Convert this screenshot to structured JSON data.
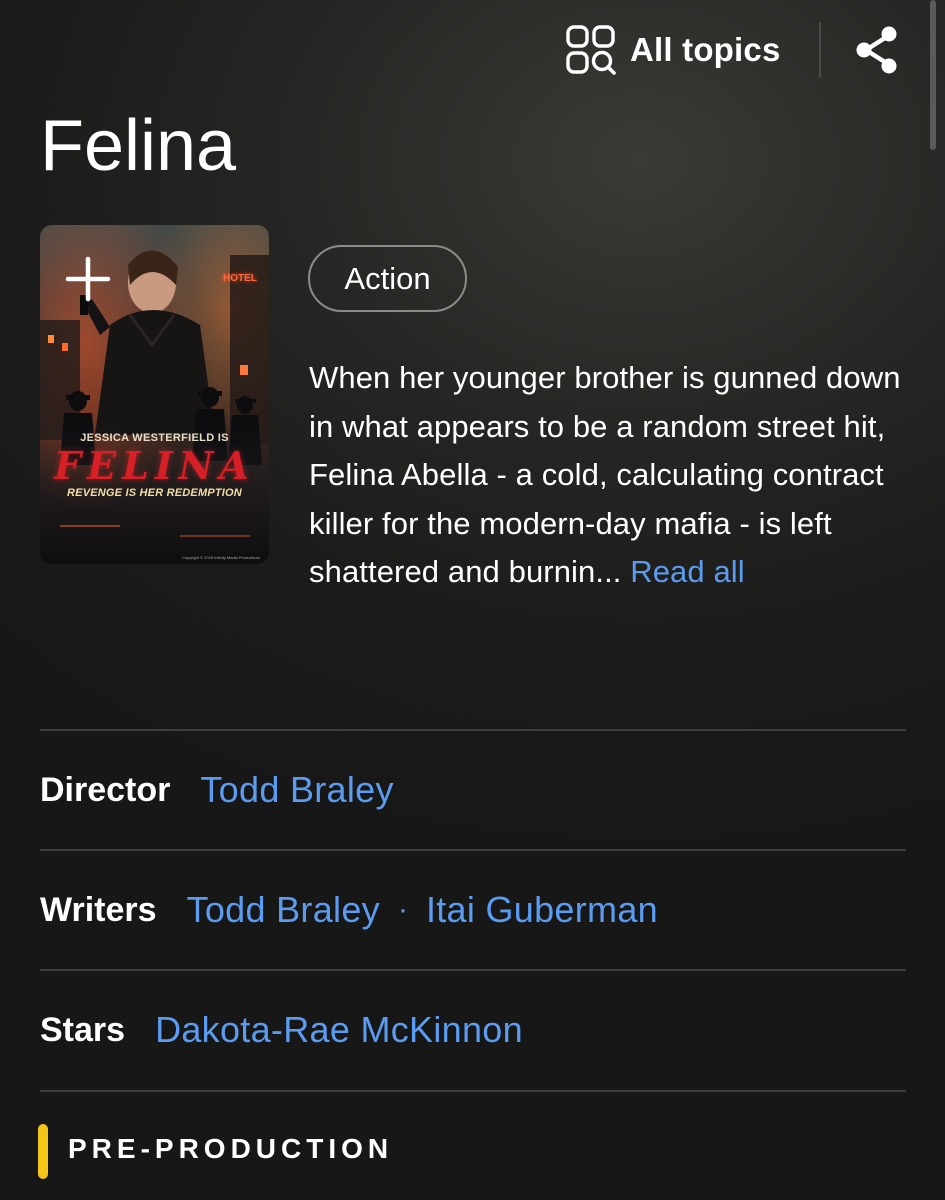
{
  "colors": {
    "accent_link": "#5b9bf0",
    "status_yellow": "#f5c518",
    "poster_title_red": "#d61f26"
  },
  "header": {
    "all_topics_label": "All topics",
    "all_topics_icon": "topics-grid-search-icon",
    "share_icon": "share-icon"
  },
  "title": "Felina",
  "poster": {
    "add_icon": "plus-icon",
    "tagline_top": "JESSICA WESTERFIELD IS",
    "poster_title": "FELINA",
    "tagline_bottom": "REVENGE IS HER REDEMPTION",
    "sign_text": "HOTEL",
    "copyright": "Copyright © 2025 Infinity Media Productions"
  },
  "genre": "Action",
  "plot": {
    "text": "When her younger brother is gunned down in what appears to be a random street hit, Felina Abella - a cold, calculating contract killer for the modern-day mafia - is left shattered and burnin...",
    "read_all_label": "Read all"
  },
  "credits": {
    "director": {
      "label": "Director",
      "names": [
        "Todd Braley"
      ]
    },
    "writers": {
      "label": "Writers",
      "names": [
        "Todd Braley",
        "Itai Guberman"
      ],
      "separator": "·"
    },
    "stars": {
      "label": "Stars",
      "names": [
        "Dakota-Rae McKinnon"
      ]
    }
  },
  "status": "PRE-PRODUCTION"
}
